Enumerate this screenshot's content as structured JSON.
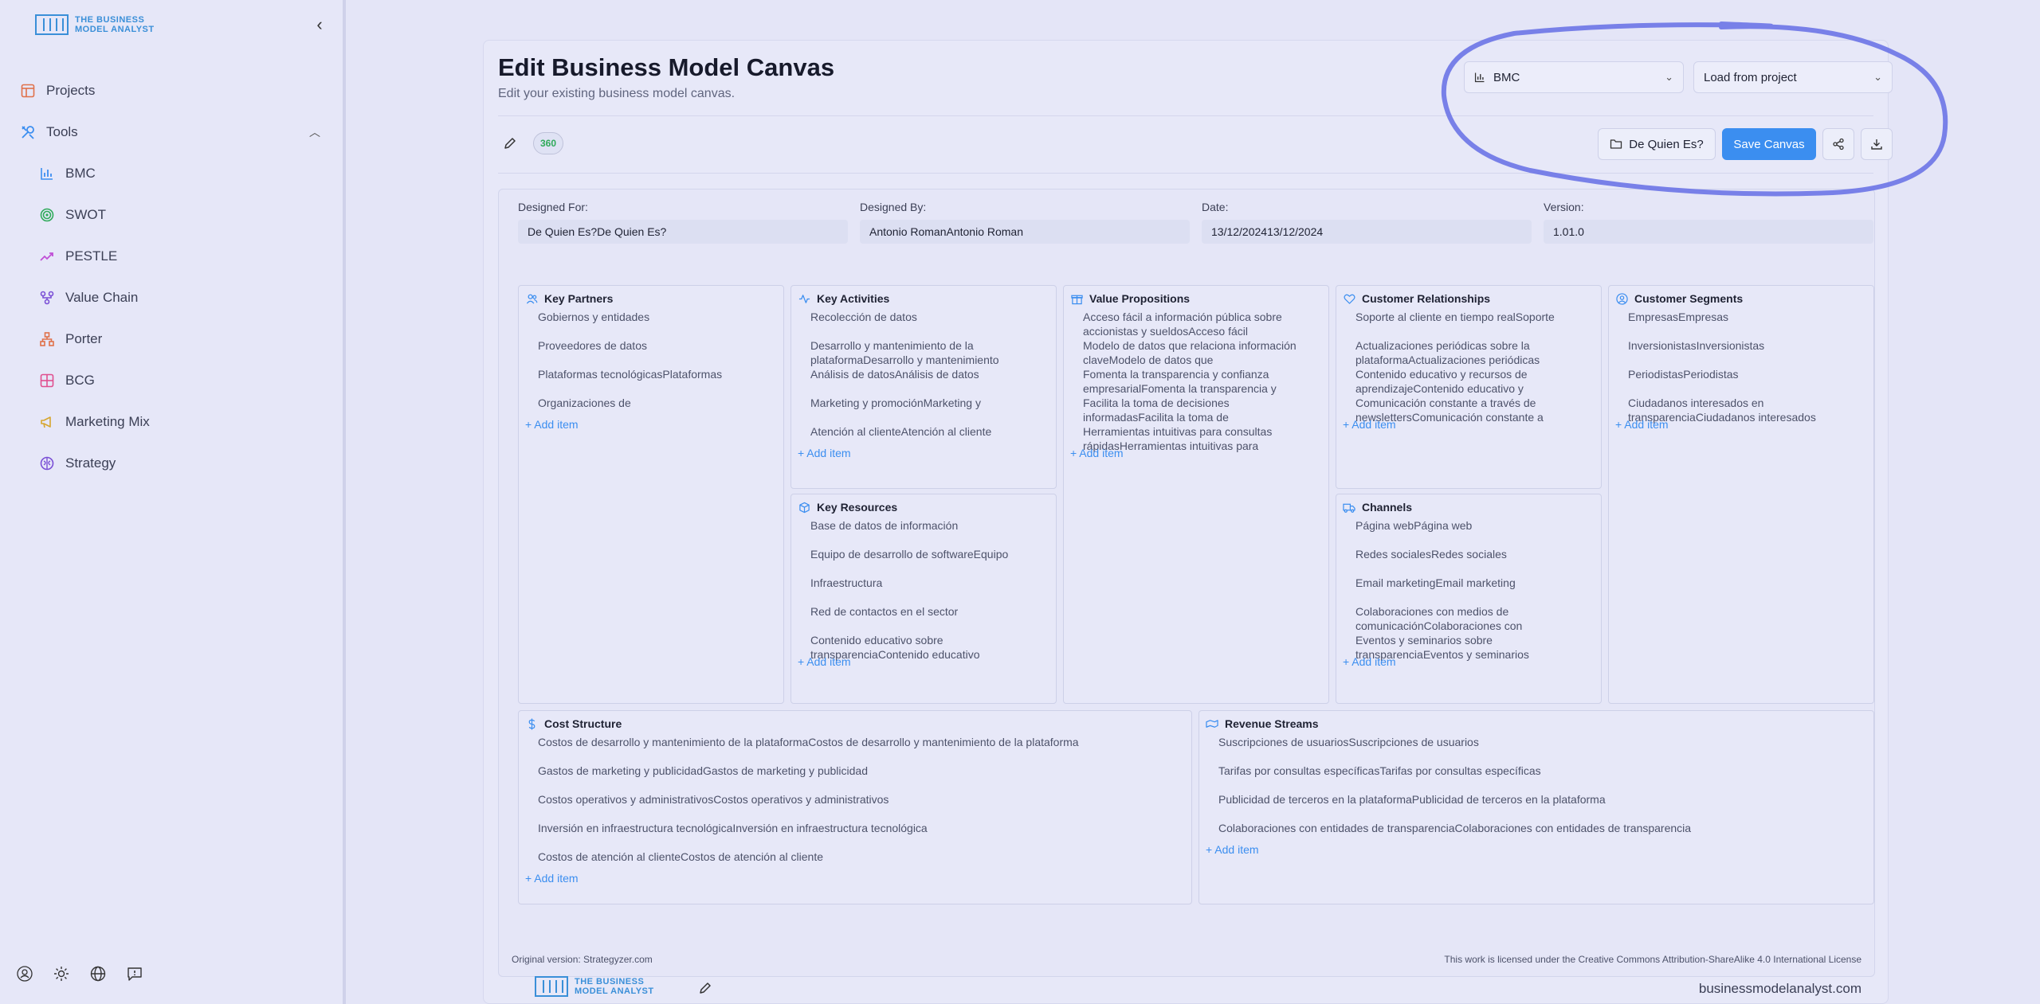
{
  "brand": {
    "logo_line1": "THE BUSINESS",
    "logo_line2": "MODEL ANALYST"
  },
  "sidebar": {
    "items": [
      {
        "label": "Projects",
        "icon": "layout-icon",
        "color": "#e0714a"
      },
      {
        "label": "Tools",
        "icon": "tools-icon",
        "color": "#3b8ef0"
      },
      {
        "label": "BMC",
        "icon": "bar-chart-icon",
        "color": "#3b8ef0"
      },
      {
        "label": "SWOT",
        "icon": "target-icon",
        "color": "#2faa5a"
      },
      {
        "label": "PESTLE",
        "icon": "trending-up-icon",
        "color": "#c04fd6"
      },
      {
        "label": "Value Chain",
        "icon": "workflow-icon",
        "color": "#7a4fd6"
      },
      {
        "label": "Porter",
        "icon": "network-icon",
        "color": "#e0714a"
      },
      {
        "label": "BCG",
        "icon": "grid-icon",
        "color": "#e04f8f"
      },
      {
        "label": "Marketing Mix",
        "icon": "megaphone-icon",
        "color": "#d6a62f"
      },
      {
        "label": "Strategy",
        "icon": "brain-icon",
        "color": "#7a4fd6"
      }
    ]
  },
  "header": {
    "title": "Edit Business Model Canvas",
    "subtitle": "Edit your existing business model canvas.",
    "type_select": "BMC",
    "load_select": "Load from project"
  },
  "toolbar": {
    "badge": "360",
    "project_button": "De Quien Es?",
    "save_button": "Save Canvas"
  },
  "meta": {
    "designed_for_label": "Designed For:",
    "designed_for": "De Quien Es?De Quien Es?",
    "designed_by_label": "Designed By:",
    "designed_by": "Antonio RomanAntonio Roman",
    "date_label": "Date:",
    "date": "13/12/202413/12/2024",
    "version_label": "Version:",
    "version": "1.01.0"
  },
  "blocks": {
    "key_partners": {
      "title": "Key Partners",
      "items": [
        "Gobiernos y entidades",
        "Proveedores de datos",
        "Plataformas tecnológicasPlataformas",
        "Organizaciones de"
      ]
    },
    "key_activities": {
      "title": "Key Activities",
      "items": [
        "Recolección de datos",
        "Desarrollo y mantenimiento de la plataformaDesarrollo y mantenimiento",
        "Análisis de datosAnálisis de datos",
        "Marketing y promociónMarketing y",
        "Atención al clienteAtención al cliente"
      ]
    },
    "key_resources": {
      "title": "Key Resources",
      "items": [
        "Base de datos de información",
        "Equipo de desarrollo de softwareEquipo",
        "Infraestructura",
        "Red de contactos en el sector",
        "Contenido educativo sobre transparenciaContenido educativo"
      ]
    },
    "value_propositions": {
      "title": "Value Propositions",
      "items": [
        "Acceso fácil a información pública sobre accionistas y sueldosAcceso fácil",
        "Modelo de datos que relaciona información claveModelo de datos que",
        "Fomenta la transparencia y confianza empresarialFomenta la transparencia y",
        "Facilita la toma de decisiones informadasFacilita la toma de",
        "Herramientas intuitivas para consultas rápidasHerramientas intuitivas para"
      ]
    },
    "customer_relationships": {
      "title": "Customer Relationships",
      "items": [
        "Soporte al cliente en tiempo realSoporte",
        "Actualizaciones periódicas sobre la plataformaActualizaciones periódicas",
        "Contenido educativo y recursos de aprendizajeContenido educativo y",
        "Comunicación constante a través de newslettersComunicación constante a"
      ]
    },
    "channels": {
      "title": "Channels",
      "items": [
        "Página webPágina web",
        "Redes socialesRedes sociales",
        "Email marketingEmail marketing",
        "Colaboraciones con medios de comunicaciónColaboraciones con",
        "Eventos y seminarios sobre transparenciaEventos y seminarios"
      ]
    },
    "customer_segments": {
      "title": "Customer Segments",
      "items": [
        "EmpresasEmpresas",
        "InversionistasInversionistas",
        "PeriodistasPeriodistas",
        "Ciudadanos interesados en transparenciaCiudadanos interesados"
      ]
    },
    "cost_structure": {
      "title": "Cost Structure",
      "items": [
        "Costos de desarrollo y mantenimiento de la plataformaCostos de desarrollo y mantenimiento de la plataforma",
        "Gastos de marketing y publicidadGastos de marketing y publicidad",
        "Costos operativos y administrativosCostos operativos y administrativos",
        "Inversión en infraestructura tecnológicaInversión en infraestructura tecnológica",
        "Costos de atención al clienteCostos de atención al cliente"
      ]
    },
    "revenue_streams": {
      "title": "Revenue Streams",
      "items": [
        "Suscripciones de usuariosSuscripciones de usuarios",
        "Tarifas por consultas específicasTarifas por consultas específicas",
        "Publicidad de terceros en la plataformaPublicidad de terceros en la plataforma",
        "Colaboraciones con entidades de transparenciaColaboraciones con entidades de transparencia"
      ]
    },
    "add_item": "+ Add item"
  },
  "footer": {
    "original": "Original version: Strategyzer.com",
    "license": "This work is licensed under the Creative Commons Attribution-ShareAlike 4.0 International License",
    "site": "businessmodelanalyst.com"
  },
  "colors": {
    "accent": "#3b8ef0",
    "annotation": "#6c74e6"
  }
}
